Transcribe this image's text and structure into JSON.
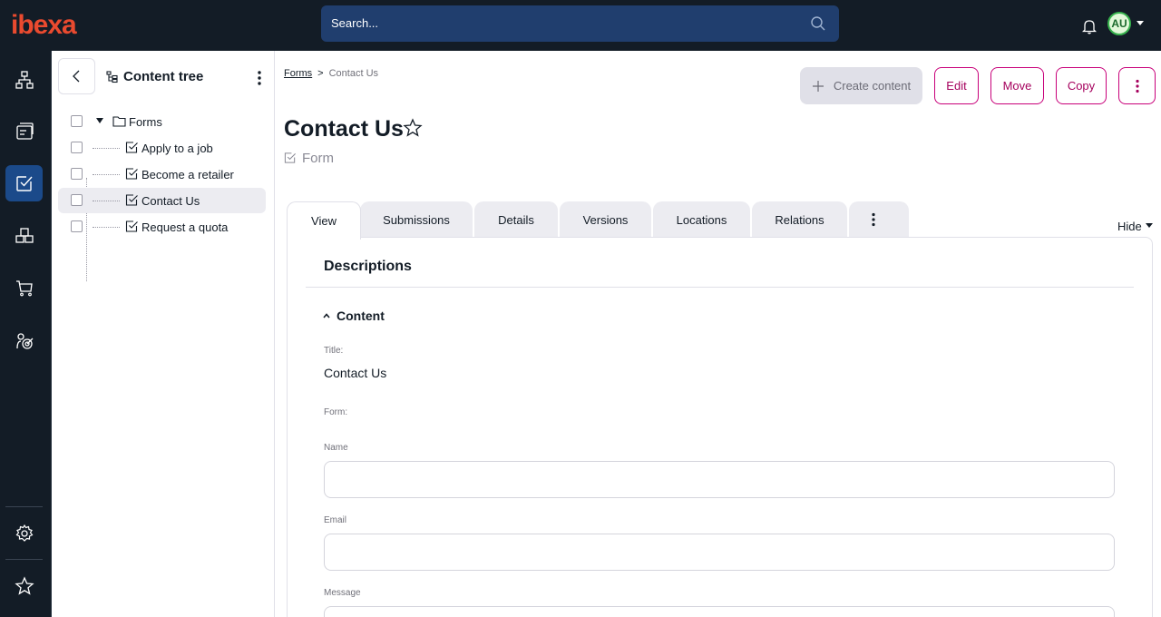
{
  "brand": {
    "logo_text": "ibexa",
    "logo_color": "#e94a2f"
  },
  "search": {
    "placeholder": "Search..."
  },
  "header": {
    "avatar_initials": "AU"
  },
  "rail": {
    "items": [
      {
        "name": "structure",
        "icon": "sitemap-icon"
      },
      {
        "name": "content",
        "icon": "content-icon"
      },
      {
        "name": "forms",
        "icon": "form-check-icon",
        "active": true
      },
      {
        "name": "catalog",
        "icon": "boxes-icon"
      },
      {
        "name": "commerce",
        "icon": "cart-icon"
      },
      {
        "name": "personalization",
        "icon": "target-icon"
      }
    ],
    "bottom": [
      {
        "name": "settings",
        "icon": "gear-icon"
      },
      {
        "name": "bookmarks",
        "icon": "star-icon"
      }
    ]
  },
  "tree": {
    "title": "Content tree",
    "root": {
      "label": "Forms"
    },
    "items": [
      {
        "label": "Apply to a job"
      },
      {
        "label": "Become a retailer"
      },
      {
        "label": "Contact Us",
        "selected": true
      },
      {
        "label": "Request a quota"
      }
    ]
  },
  "breadcrumb": {
    "parent": "Forms",
    "separator": ">",
    "current": "Contact Us"
  },
  "toolbar": {
    "create": "Create content",
    "edit": "Edit",
    "move": "Move",
    "copy": "Copy"
  },
  "page": {
    "title": "Contact Us",
    "type": "Form"
  },
  "tabs": {
    "items": [
      "View",
      "Submissions",
      "Details",
      "Versions",
      "Locations",
      "Relations"
    ],
    "active": "View",
    "hide_label": "Hide"
  },
  "view": {
    "section_title": "Descriptions",
    "group_title": "Content",
    "title_label": "Title:",
    "title_value": "Contact Us",
    "form_label": "Form:",
    "fields": [
      {
        "label": "Name"
      },
      {
        "label": "Email"
      },
      {
        "label": "Message"
      }
    ]
  },
  "colors": {
    "topbar": "#131c26",
    "search_bg": "#203e6e",
    "accent": "#c8007a",
    "rail_active": "#1b4a8a",
    "avatar_bg": "#e2f8d9"
  }
}
